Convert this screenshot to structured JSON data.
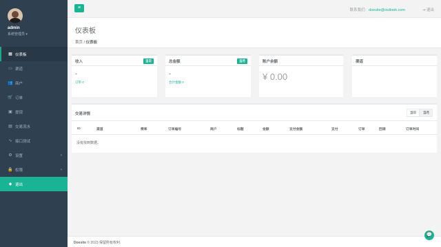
{
  "sidebar": {
    "user": {
      "name": "admin",
      "role": "系统管理员 ▾"
    },
    "items": [
      {
        "label": "仪表板",
        "icon": "dashboard-icon",
        "glyph": "▦"
      },
      {
        "label": "渠道",
        "icon": "monitor-icon",
        "glyph": "▭"
      },
      {
        "label": "商户",
        "icon": "users-icon",
        "glyph": "👥"
      },
      {
        "label": "订单",
        "icon": "cart-icon",
        "glyph": "🛒"
      },
      {
        "label": "提现",
        "icon": "wallet-icon",
        "glyph": "▣"
      },
      {
        "label": "交易流水",
        "icon": "chart-icon",
        "glyph": "▤"
      },
      {
        "label": "接口测试",
        "icon": "pulse-icon",
        "glyph": "∿"
      },
      {
        "label": "设置",
        "icon": "gear-icon",
        "glyph": "⚙"
      },
      {
        "label": "权限",
        "icon": "lock-icon",
        "glyph": "🔒"
      },
      {
        "label": "退出",
        "icon": "diamond-icon",
        "glyph": "◆"
      }
    ]
  },
  "topbar": {
    "menu_glyph": "≡",
    "contact_label": "联系我们:",
    "contact_email": "doesite@outlook.com",
    "exit_label": "⇥ 退出"
  },
  "heading": {
    "title": "仪表板",
    "crumb_home": "首页",
    "crumb_sep": " / ",
    "crumb_current": "仪表板"
  },
  "stats": {
    "income": {
      "title": "收入",
      "badge": "当日",
      "value": "-",
      "note": "订单 0"
    },
    "total": {
      "title": "总金额",
      "badge": "当月",
      "value": "-",
      "note": "合计金额 0"
    },
    "balance": {
      "title": "账户余额",
      "value": "¥ 0.00"
    },
    "channel": {
      "title": "渠道"
    }
  },
  "transactions": {
    "title": "交易详情",
    "tabs": [
      "当日",
      "当月"
    ],
    "columns": [
      "ID",
      "渠道",
      "费率",
      "订单编号",
      "商户",
      "标题",
      "金额",
      "支付金额",
      "支付",
      "订单",
      "回调",
      "订单时间"
    ],
    "empty": "没有找到数据。"
  },
  "footer": {
    "brand": "Doesite",
    "text": " © 2023 保留所有权利."
  },
  "colors": {
    "accent": "#1ab394",
    "sidebar": "#2f4050"
  }
}
